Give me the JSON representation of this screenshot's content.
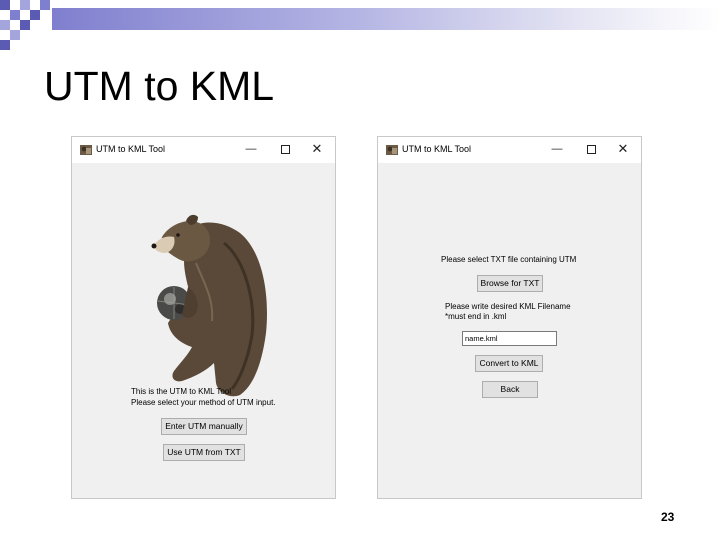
{
  "slide": {
    "title": "UTM to KML",
    "page_number": "23",
    "header_colors": {
      "checker_dark": "#5b5bb4",
      "checker_light": "#a5a5de",
      "bar_start": "#7f7fcf"
    }
  },
  "windows": [
    {
      "title": "UTM to KML Tool",
      "controls": {
        "minimize": "—",
        "close": "✕"
      },
      "intro_line1": "This is the UTM to KML Tool",
      "intro_line2": "Please select your method of UTM input.",
      "buttons": {
        "manual": "Enter UTM manually",
        "from_txt": "Use UTM from TXT"
      },
      "image": "bear-illustration"
    },
    {
      "title": "UTM to KML Tool",
      "controls": {
        "minimize": "—",
        "close": "✕"
      },
      "select_prompt": "Please select TXT file containing UTM",
      "browse_button": "Browse for TXT",
      "filename_prompt_line1": "Please write desired KML Filename",
      "filename_prompt_line2": "*must end in .kml",
      "filename_value": "name.kml",
      "convert_button": "Convert to KML",
      "back_button": "Back"
    }
  ]
}
